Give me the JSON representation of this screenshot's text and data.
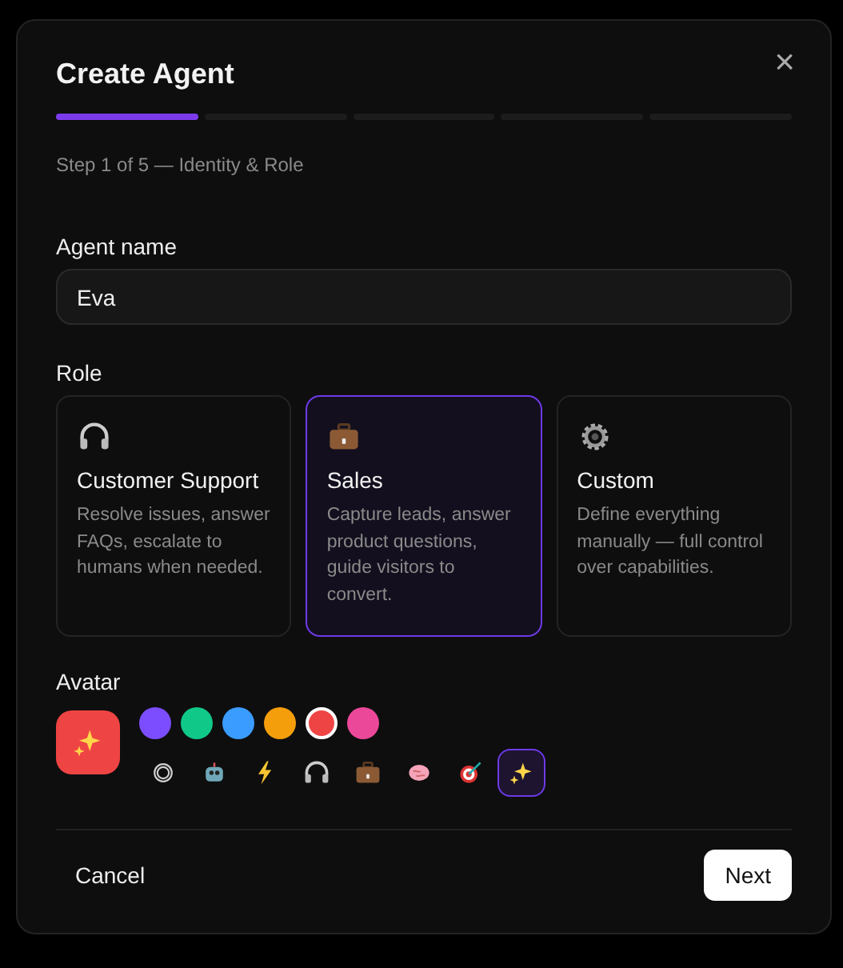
{
  "dialog": {
    "title": "Create Agent",
    "close": "×"
  },
  "steps": [
    {
      "selected": true
    },
    {
      "selected": false
    },
    {
      "selected": false
    },
    {
      "selected": false
    },
    {
      "selected": false
    }
  ],
  "step_label": "Step 1 of 5 — Identity & Role",
  "name_field": {
    "label": "Agent name",
    "value": "Eva"
  },
  "role": {
    "label": "Role",
    "options": [
      {
        "title": "Customer Support",
        "description": "Resolve issues, answer FAQs, escalate to humans when needed.",
        "selected": false
      },
      {
        "title": "Sales",
        "description": "Capture leads, answer product questions, guide visitors to convert.",
        "selected": true
      },
      {
        "title": "Custom",
        "description": "Define everything manually — full control over capabilities.",
        "selected": false
      }
    ]
  },
  "avatar": {
    "label": "Avatar",
    "colors": [
      {
        "color": "#7c4dff",
        "selected": false
      },
      {
        "color": "#10c988",
        "selected": false
      },
      {
        "color": "#3b9cff",
        "selected": false
      },
      {
        "color": "#f59e0b",
        "selected": false
      },
      {
        "color": "#ef4444",
        "selected": true
      },
      {
        "color": "#ec4899",
        "selected": false
      }
    ],
    "icons": [
      {
        "selected": false
      },
      {
        "selected": false
      },
      {
        "selected": false
      },
      {
        "selected": false
      },
      {
        "selected": false
      },
      {
        "selected": false
      },
      {
        "selected": false
      },
      {
        "selected": true
      }
    ]
  },
  "footer": {
    "cancel": "Cancel",
    "next": "Next"
  }
}
